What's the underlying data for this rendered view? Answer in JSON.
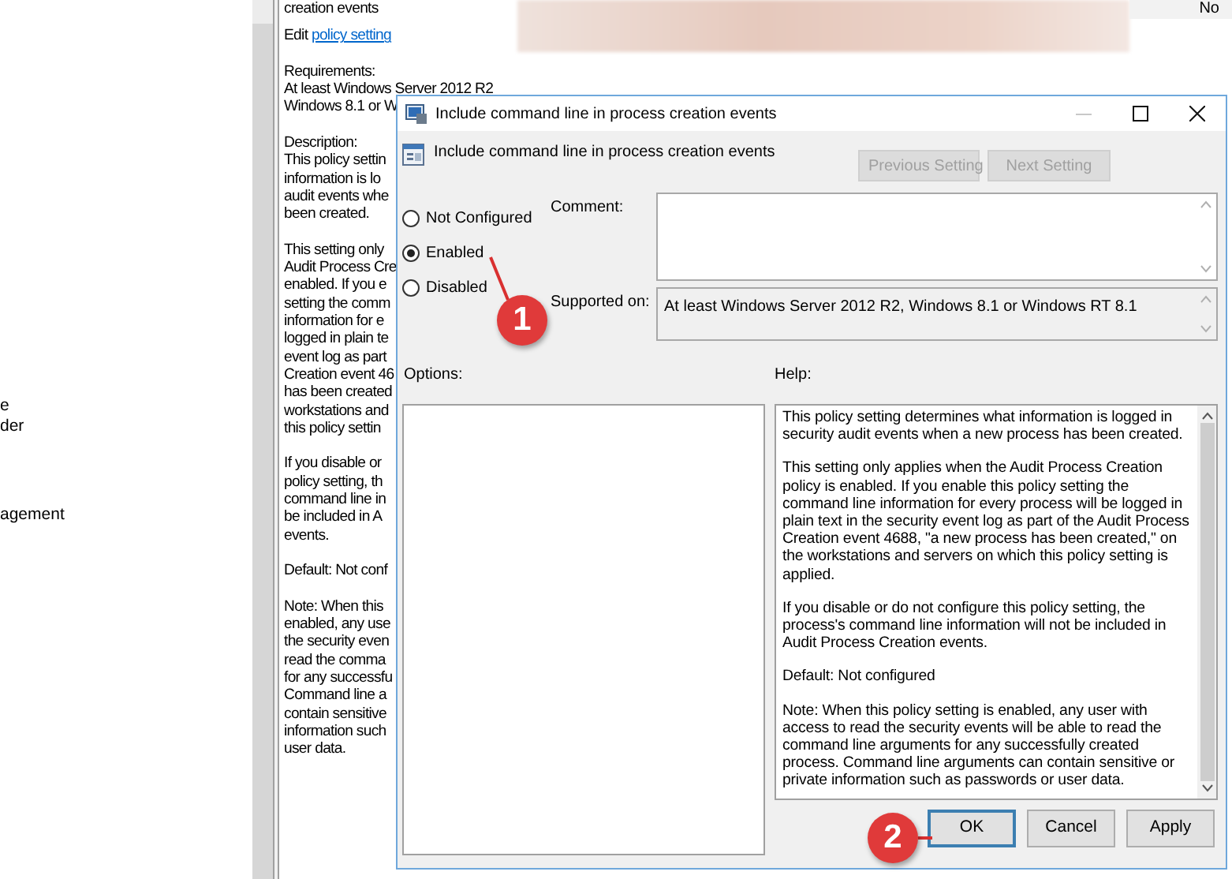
{
  "tree": {
    "items": [
      "e",
      "der",
      "agement"
    ]
  },
  "description_pane": {
    "heading": "creation events",
    "edit_prefix": "Edit",
    "edit_link": "policy setting",
    "paragraphs": [
      [
        "Requirements:",
        "At least Windows Server 2012 R2",
        "Windows 8.1 or W"
      ],
      [
        "Description:",
        "This policy settin",
        "information is lo",
        "audit events whe",
        "been created."
      ],
      [
        "This setting only",
        "Audit Process Cre",
        "enabled. If you e",
        "setting the comm",
        "information for e",
        "logged in plain te",
        "event log as part",
        "Creation event 46",
        "has been created",
        "workstations and",
        "this policy settin"
      ],
      [
        "If you disable or",
        "policy setting, th",
        "command line in",
        "be included in A",
        "events."
      ],
      [
        "Default: Not conf"
      ],
      [
        "Note: When this",
        "enabled, any use",
        "the security even",
        "read the comma",
        "for any successfu",
        "Command line a",
        "contain sensitive",
        "information such",
        "user data."
      ]
    ]
  },
  "column_header": "No",
  "dialog": {
    "title": "Include command line in process creation events",
    "setting_name": "Include command line in process creation events",
    "nav_buttons": [
      {
        "label": "Previous Setting",
        "disabled": true
      },
      {
        "label": "Next Setting",
        "disabled": true
      }
    ],
    "states": [
      {
        "label": "Not Configured",
        "selected": false
      },
      {
        "label": "Enabled",
        "selected": true
      },
      {
        "label": "Disabled",
        "selected": false
      }
    ],
    "comment_label": "Comment:",
    "supported_label": "Supported on:",
    "supported_value": "At least Windows Server 2012 R2, Windows 8.1 or Windows RT 8.1",
    "options_label": "Options:",
    "help_label": "Help:",
    "help": [
      "This policy setting determines what information is logged in security audit events when a new process has been created.",
      "This setting only applies when the Audit Process Creation policy is enabled. If you enable this policy setting the command line information for every process will be logged in plain text in the security event log as part of the Audit Process Creation event 4688, \"a new process has been created,\" on the workstations and servers on which this policy setting is applied.",
      "If you disable or do not configure this policy setting, the process's command line information will not be included in Audit Process Creation events.",
      "Default: Not configured",
      "Note: When this policy setting is enabled, any user with access to read the security events will be able to read the command line arguments for any successfully created process. Command line arguments can contain sensitive or private information such as passwords or user data."
    ],
    "buttons": [
      {
        "label": "OK",
        "default": true
      },
      {
        "label": "Cancel",
        "default": false
      },
      {
        "label": "Apply",
        "default": false
      }
    ]
  },
  "annotations": [
    {
      "number": "1"
    },
    {
      "number": "2"
    }
  ]
}
